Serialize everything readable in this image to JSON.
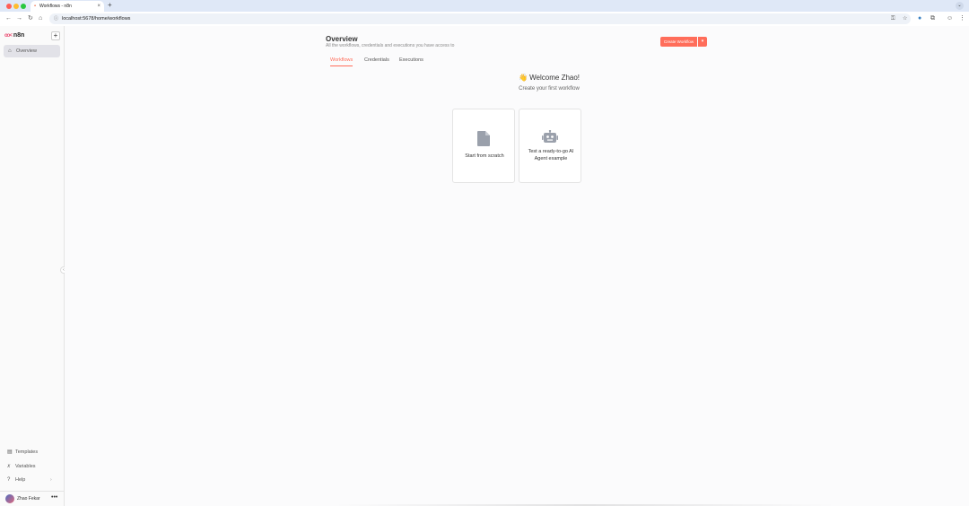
{
  "browser": {
    "tab_title": "Workflows - n8n",
    "tab_favicon": "n8n-icon",
    "tab_close": "×",
    "new_tab": "+",
    "url": "localhost:5678/home/workflows"
  },
  "sidebar": {
    "logo_text": "n8n",
    "logo_mark": "oo<",
    "add_label": "+",
    "nav": [
      {
        "label": "Overview",
        "icon": "home-icon"
      }
    ],
    "bottom": [
      {
        "label": "Templates",
        "icon": "templates-icon"
      },
      {
        "label": "Variables",
        "icon": "variables-icon"
      },
      {
        "label": "Help",
        "icon": "help-icon"
      }
    ],
    "user_name": "Zhao Fekar",
    "user_more": "•••"
  },
  "main": {
    "title": "Overview",
    "subtitle": "All the workflows, credentials and executions you have access to",
    "create_label": "Create Workflow",
    "tabs": [
      "Workflows",
      "Credentials",
      "Executions"
    ],
    "active_tab": "Workflows",
    "welcome": "👋 Welcome Zhao!",
    "welcome_sub": "Create your first workflow",
    "cards": [
      {
        "label": "Start from scratch",
        "icon": "file-icon"
      },
      {
        "label": "Test a ready-to-go AI Agent example",
        "icon": "robot-icon"
      }
    ]
  },
  "colors": {
    "accent": "#ff6d5a",
    "browser_chrome": "#dfe8f7",
    "sidebar_bg": "#fafafa"
  }
}
